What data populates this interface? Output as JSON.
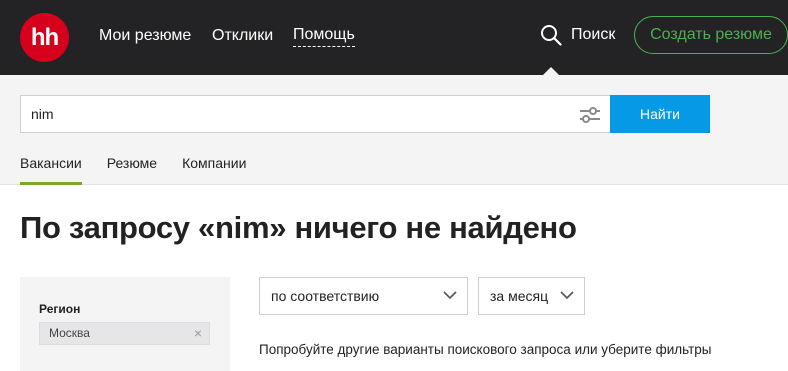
{
  "header": {
    "logo_text": "hh",
    "nav": [
      "Мои резюме",
      "Отклики",
      "Помощь"
    ],
    "search_label": "Поиск",
    "create_resume_label": "Создать резюме"
  },
  "search": {
    "query": "nim",
    "find_label": "Найти"
  },
  "tabs": [
    {
      "label": "Вакансии",
      "active": true
    },
    {
      "label": "Резюме",
      "active": false
    },
    {
      "label": "Компании",
      "active": false
    }
  ],
  "main": {
    "title": "По запросу «nim» ничего не найдено",
    "sort_select": "по соответствию",
    "period_select": "за месяц",
    "hint": "Попробуйте другие варианты поискового запроса или уберите фильтры"
  },
  "sidebar": {
    "region_label": "Регион",
    "region_value": "Москва",
    "region_remove": "×"
  },
  "colors": {
    "header_bg": "#232325",
    "logo_red": "#d6001c",
    "accent_green": "#4cb051",
    "button_blue": "#0599e6",
    "tab_underline": "#7aa829",
    "panel_bg": "#f4f4f5"
  },
  "icons": {
    "search": "magnifier-icon",
    "filters": "sliders-icon",
    "dropdown": "chevron-down-icon",
    "remove": "close-icon"
  }
}
